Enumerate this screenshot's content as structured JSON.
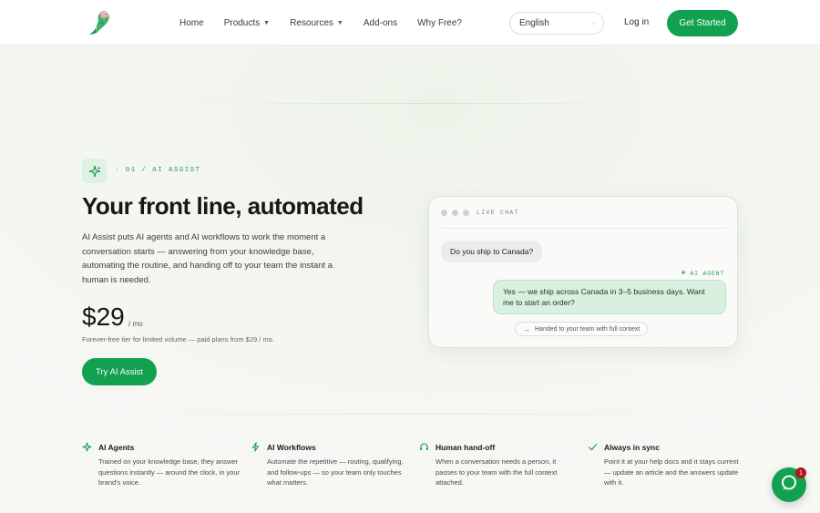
{
  "nav": {
    "items": [
      {
        "label": "Home",
        "has_chevron": false
      },
      {
        "label": "Products",
        "has_chevron": true
      },
      {
        "label": "Resources",
        "has_chevron": true
      },
      {
        "label": "Add-ons",
        "has_chevron": false
      },
      {
        "label": "Why Free?",
        "has_chevron": false
      }
    ],
    "language": "English",
    "login": "Log in",
    "cta": "Get Started"
  },
  "hero": {
    "eyebrow": "· 01 / AI ASSIST",
    "title": "Your front line, automated",
    "description": "AI Assist puts AI agents and AI workflows to work the moment a conversation starts — answering from your knowledge base, automating the routine, and handing off to your team the instant a human is needed.",
    "price": "$29",
    "price_unit": "/ mo",
    "price_note": "Forever-free tier for limited volume — paid plans from $29 / mo.",
    "button": "Try AI Assist"
  },
  "chat": {
    "label": "LIVE CHAT",
    "user_message": "Do you ship to Canada?",
    "agent_tag": "AI AGENT",
    "agent_message": "Yes — we ship across Canada in 3–5 business days. Want me to start an order?",
    "handoff": "Handed to your team with full context"
  },
  "features": [
    {
      "icon": "sparkles-icon",
      "title": "AI Agents",
      "text": "Trained on your knowledge base, they answer questions instantly — around the clock, in your brand's voice."
    },
    {
      "icon": "bolt-icon",
      "title": "AI Workflows",
      "text": "Automate the repetitive — routing, qualifying, and follow-ups — so your team only touches what matters."
    },
    {
      "icon": "headset-icon",
      "title": "Human hand-off",
      "text": "When a conversation needs a person, it passes to your team with the full context attached."
    },
    {
      "icon": "check-icon",
      "title": "Always in sync",
      "text": "Point it at your help docs and it stays current — update an article and the answers update with it."
    }
  ],
  "chat_widget": {
    "badge": "1"
  },
  "colors": {
    "accent": "#12a150",
    "accent_light": "#dff1e4",
    "badge": "#b3141f"
  }
}
